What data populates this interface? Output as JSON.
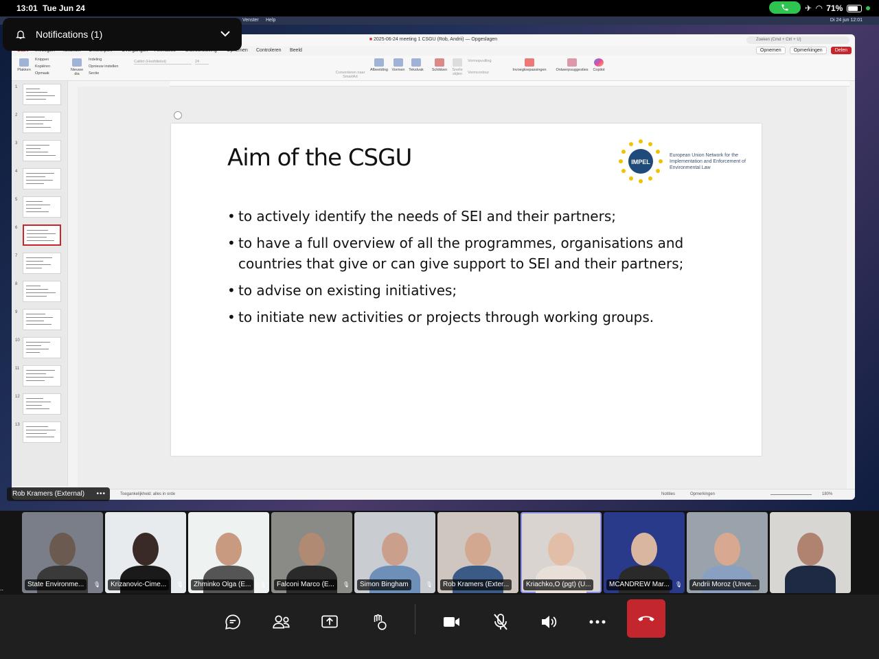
{
  "status_bar": {
    "time": "13:01",
    "date": "Tue Jun 24",
    "battery": "71%"
  },
  "notifications": {
    "label": "Notifications (1)"
  },
  "mac_menu": {
    "venster": "Venster",
    "help": "Help",
    "clock": "Di 24 jun  12:01"
  },
  "powerpoint": {
    "document_title": "2025-06-24 meeting 1 CSGU (Rob, Andrii) — Opgeslagen",
    "search_placeholder": "Zoeken (Cmd + Ctrl + U)",
    "tabs": [
      "Start",
      "Invoegen",
      "Tekenen",
      "Ontwerpen",
      "Overgangen",
      "Animaties",
      "Diavoorstelling",
      "Opnemen",
      "Controleren",
      "Beeld"
    ],
    "actions": {
      "record": "Opnemen",
      "comments": "Opmerkingen",
      "share": "Delen"
    },
    "ribbon": {
      "paste": "Plakken",
      "cut": "Knippen",
      "copy": "Kopiëren",
      "format": "Opmaak",
      "new_slide": "Nieuwe dia",
      "layout": "Indeling",
      "reset": "Opnieuw instellen",
      "section": "Sectie",
      "font_name": "Calibri (Hoofdtekst)",
      "font_size": "24",
      "convert_smartart": "Converteren naar SmartArt",
      "picture": "Afbeelding",
      "shapes": "Vormen",
      "textbox": "Tekstvak",
      "arrange": "Schikken",
      "quick_styles": "Snelle stijlen",
      "shape_fill": "Vormopvulling",
      "shape_outline": "Vormcontour",
      "addins": "Invoegtoepassingen",
      "designer": "Ontwerpsuggesties",
      "copilot": "Copilot"
    },
    "slide_numbers": [
      "1",
      "2",
      "3",
      "4",
      "5",
      "6",
      "7",
      "8",
      "9",
      "10",
      "11",
      "12",
      "13"
    ],
    "selected_slide": 6,
    "status": {
      "accessibility": "Toegankelijkheid: alles in orde",
      "notes": "Notities",
      "comments": "Opmerkingen",
      "zoom": "180%"
    }
  },
  "slide": {
    "title": "Aim of the CSGU",
    "logo_badge": "IMPEL",
    "logo_text": "European Union Network for the Implementation and Enforcement of Environmental Law",
    "bullets": [
      "to actively identify the needs of SEI and their partners;",
      "to have a full overview of all the programmes, organisations and countries that give or can give support to SEI and their partners;",
      "to advise on existing initiatives;",
      "to initiate new activities or projects through working groups."
    ]
  },
  "presenter": {
    "name": "Rob Kramers (External)"
  },
  "participants": [
    {
      "name": "State Environme...",
      "muted": true
    },
    {
      "name": "Krizanovic-Cime...",
      "muted": true
    },
    {
      "name": "Zhminko Olga (E...",
      "muted": true
    },
    {
      "name": "Falconi Marco (E...",
      "muted": true
    },
    {
      "name": "Simon Bingham",
      "muted": true
    },
    {
      "name": "Rob Kramers (Exter...",
      "muted": false
    },
    {
      "name": "Kriachko,O (pgt) (U...",
      "muted": false
    },
    {
      "name": "MCANDREW Mar...",
      "muted": true
    },
    {
      "name": "Andrii Moroz (Unve...",
      "muted": false
    },
    {
      "name": "",
      "muted": false
    }
  ],
  "controls": [
    "chat",
    "people",
    "share",
    "react",
    "camera",
    "mute",
    "speaker",
    "more",
    "leave"
  ]
}
